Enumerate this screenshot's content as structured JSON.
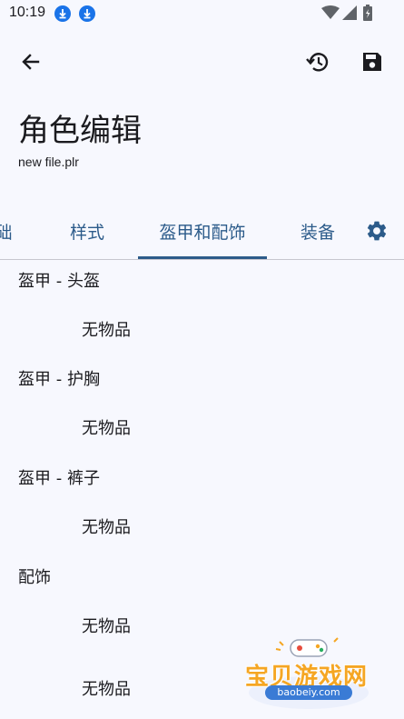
{
  "status_bar": {
    "time": "10:19",
    "icons": [
      "download-icon",
      "download-icon",
      "wifi-icon",
      "signal-icon",
      "battery-icon"
    ]
  },
  "app_bar": {
    "back_icon": "arrow-back-icon",
    "history_icon": "history-icon",
    "save_icon": "save-icon"
  },
  "header": {
    "title": "角色编辑",
    "file_name": "new file.plr"
  },
  "tabs": [
    {
      "label": "础",
      "active": false
    },
    {
      "label": "样式",
      "active": false
    },
    {
      "label": "盔甲和配饰",
      "active": true
    },
    {
      "label": "装备",
      "active": false
    }
  ],
  "tabs_settings_icon": "gear-icon",
  "accent_color": "#2c5b8a",
  "sections": [
    {
      "heading": "盔甲 - 头盔",
      "value": "无物品"
    },
    {
      "heading": "盔甲 - 护胸",
      "value": "无物品"
    },
    {
      "heading": "盔甲 - 裤子",
      "value": "无物品"
    },
    {
      "heading": "配饰",
      "value": "无物品"
    }
  ],
  "extra_item": {
    "value": "无物品"
  },
  "watermark": {
    "text": "宝贝游戏网",
    "url": "baobeiy.com"
  }
}
